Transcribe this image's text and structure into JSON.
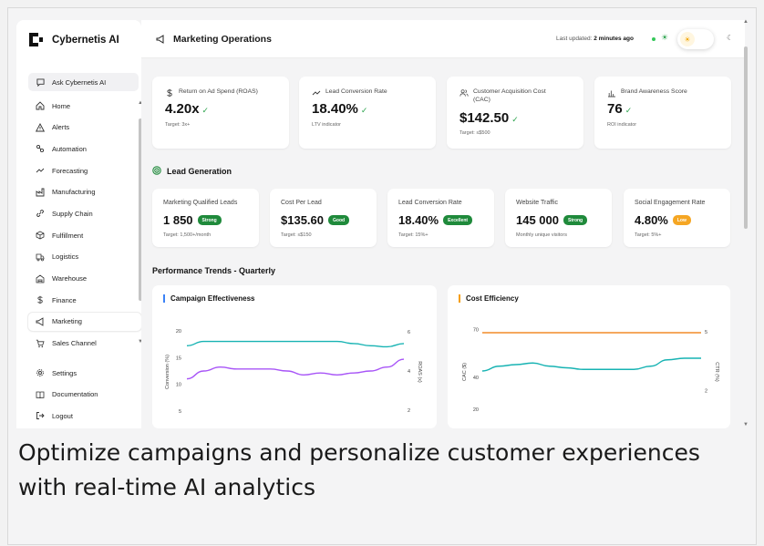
{
  "app": {
    "brand": "Cybernetis AI",
    "page_title": "Marketing Operations"
  },
  "sidebar": {
    "ask_label": "Ask Cybernetis AI",
    "items": [
      {
        "label": "Home",
        "icon": "home-icon"
      },
      {
        "label": "Alerts",
        "icon": "alert-icon"
      },
      {
        "label": "Automation",
        "icon": "automation-icon"
      },
      {
        "label": "Forecasting",
        "icon": "trend-icon"
      },
      {
        "label": "Manufacturing",
        "icon": "factory-icon"
      },
      {
        "label": "Supply Chain",
        "icon": "link-icon"
      },
      {
        "label": "Fulfillment",
        "icon": "box-icon"
      },
      {
        "label": "Logistics",
        "icon": "truck-icon"
      },
      {
        "label": "Warehouse",
        "icon": "warehouse-icon"
      },
      {
        "label": "Finance",
        "icon": "dollar-icon"
      },
      {
        "label": "Marketing",
        "icon": "megaphone-icon"
      },
      {
        "label": "Sales Channel",
        "icon": "cart-icon"
      }
    ],
    "bottom_items": [
      {
        "label": "Settings",
        "icon": "gear-icon"
      },
      {
        "label": "Documentation",
        "icon": "book-icon"
      },
      {
        "label": "Logout",
        "icon": "logout-icon"
      }
    ]
  },
  "header": {
    "updated_prefix": "Last updated:",
    "updated_value": "2 minutes ago"
  },
  "kpis": [
    {
      "label": "Return on Ad Spend (ROAS)",
      "value": "4.20x",
      "sub": "Target: 3x+",
      "icon": "dollar-icon"
    },
    {
      "label": "Lead Conversion Rate",
      "value": "18.40%",
      "sub": "LTV indicator",
      "icon": "trend-icon"
    },
    {
      "label": "Customer Acquisition Cost (CAC)",
      "value": "$142.50",
      "sub": "Target: ≤$500",
      "icon": "users-icon"
    },
    {
      "label": "Brand Awareness Score",
      "value": "76",
      "sub": "ROI indicator",
      "icon": "bar-chart-icon"
    }
  ],
  "lead_gen": {
    "title": "Lead Generation",
    "cards": [
      {
        "label": "Marketing Qualified Leads",
        "value": "1 850",
        "badge": "Strong",
        "badge_color": "#1f8a3b",
        "sub": "Target: 1,500+/month"
      },
      {
        "label": "Cost Per Lead",
        "value": "$135.60",
        "badge": "Good",
        "badge_color": "#1f8a3b",
        "sub": "Target: ≤$150"
      },
      {
        "label": "Lead Conversion Rate",
        "value": "18.40%",
        "badge": "Excellent",
        "badge_color": "#1f8a3b",
        "sub": "Target: 15%+"
      },
      {
        "label": "Website Traffic",
        "value": "145 000",
        "badge": "Strong",
        "badge_color": "#1f8a3b",
        "sub": "Monthly unique visitors"
      },
      {
        "label": "Social Engagement Rate",
        "value": "4.80%",
        "badge": "Low",
        "badge_color": "#f5a623",
        "sub": "Target: 5%+"
      }
    ]
  },
  "trends_title": "Performance Trends - Quarterly",
  "chart_data": [
    {
      "type": "line",
      "title": "Campaign Effectiveness",
      "ylabel": "Conversion (%)",
      "y2label": "ROAS (x)",
      "yticks": [
        20,
        15,
        10,
        5
      ],
      "y2ticks": [
        6,
        4,
        2
      ],
      "ylim": [
        3,
        22
      ],
      "y2lim": [
        1.4,
        6.6
      ],
      "points": 14,
      "series": [
        {
          "color": "#17b3b3",
          "axis": "left",
          "values": [
            17.2,
            18,
            18,
            18,
            18,
            18,
            18,
            18,
            18,
            18,
            17.6,
            17.2,
            17,
            17.6
          ]
        },
        {
          "color": "#a855f7",
          "axis": "right",
          "values": [
            3.6,
            4.0,
            4.2,
            4.1,
            4.1,
            4.1,
            4.0,
            3.8,
            3.9,
            3.8,
            3.9,
            4.0,
            4.2,
            4.6
          ]
        }
      ]
    },
    {
      "type": "line",
      "title": "Cost Efficiency",
      "ylabel": "CAC ($)",
      "y2label": "CTR (%)",
      "yticks": [
        70,
        40,
        20
      ],
      "y2ticks": [
        5,
        2
      ],
      "ylim": [
        12,
        76
      ],
      "y2lim": [
        0.4,
        5.6
      ],
      "points": 14,
      "series": [
        {
          "color": "#f28c28",
          "axis": "left",
          "values": [
            68,
            68,
            68,
            68,
            68,
            68,
            68,
            68,
            68,
            68,
            68,
            68,
            68,
            68
          ]
        },
        {
          "color": "#17b3b3",
          "axis": "left",
          "values": [
            44,
            47,
            48,
            49,
            47,
            46,
            45,
            45,
            45,
            45,
            47,
            51,
            52,
            52
          ]
        }
      ]
    }
  ],
  "caption": "Optimize campaigns and personalize customer experiences with real-time AI analytics"
}
